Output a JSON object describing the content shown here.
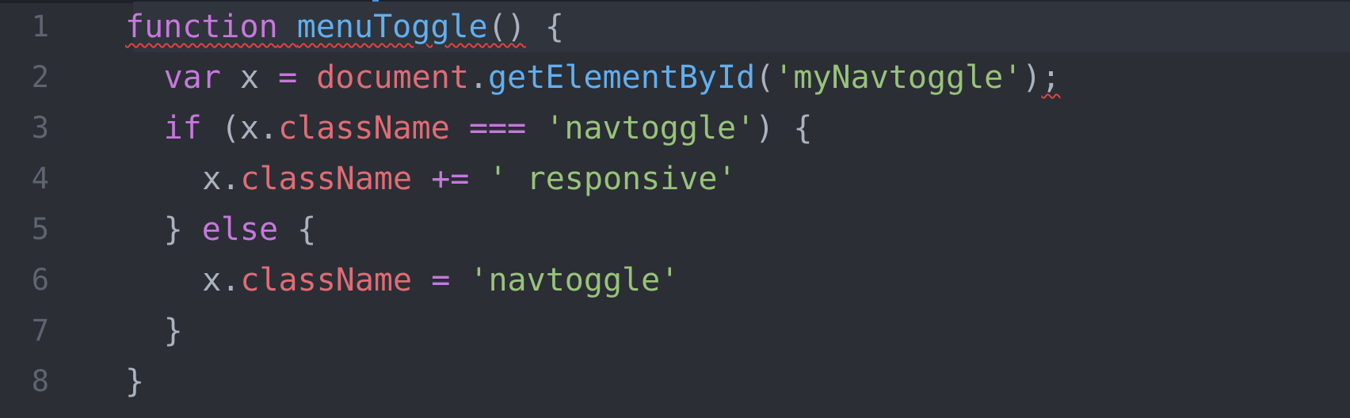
{
  "editor": {
    "lines": [
      {
        "number": "1",
        "indent": "",
        "tokens": [
          {
            "t": "function",
            "c": "kw",
            "s": true
          },
          {
            "t": " ",
            "c": "pl",
            "s": true
          },
          {
            "t": "menuToggle",
            "c": "fn",
            "s": true
          },
          {
            "t": "()",
            "c": "pl",
            "s": true
          },
          {
            "t": " {",
            "c": "pl"
          }
        ]
      },
      {
        "number": "2",
        "indent": "  ",
        "tokens": [
          {
            "t": "var",
            "c": "kw"
          },
          {
            "t": " x ",
            "c": "pl"
          },
          {
            "t": "=",
            "c": "op"
          },
          {
            "t": " ",
            "c": "pl"
          },
          {
            "t": "document",
            "c": "obj"
          },
          {
            "t": ".",
            "c": "pl"
          },
          {
            "t": "getElementById",
            "c": "fn"
          },
          {
            "t": "(",
            "c": "pl"
          },
          {
            "t": "'myNavtoggle'",
            "c": "str"
          },
          {
            "t": ")",
            "c": "pl"
          },
          {
            "t": ";",
            "c": "pl",
            "s": true
          }
        ]
      },
      {
        "number": "3",
        "indent": "  ",
        "tokens": [
          {
            "t": "if",
            "c": "kw"
          },
          {
            "t": " (x.",
            "c": "pl"
          },
          {
            "t": "className",
            "c": "obj"
          },
          {
            "t": " ",
            "c": "pl"
          },
          {
            "t": "===",
            "c": "op"
          },
          {
            "t": " ",
            "c": "pl"
          },
          {
            "t": "'navtoggle'",
            "c": "str"
          },
          {
            "t": ") {",
            "c": "pl"
          }
        ]
      },
      {
        "number": "4",
        "indent": "    ",
        "tokens": [
          {
            "t": "x.",
            "c": "pl"
          },
          {
            "t": "className",
            "c": "obj"
          },
          {
            "t": " ",
            "c": "pl"
          },
          {
            "t": "+=",
            "c": "op"
          },
          {
            "t": " ",
            "c": "pl"
          },
          {
            "t": "' responsive'",
            "c": "str"
          }
        ]
      },
      {
        "number": "5",
        "indent": "  ",
        "tokens": [
          {
            "t": "} ",
            "c": "pl"
          },
          {
            "t": "else",
            "c": "kw"
          },
          {
            "t": " {",
            "c": "pl"
          }
        ]
      },
      {
        "number": "6",
        "indent": "    ",
        "tokens": [
          {
            "t": "x.",
            "c": "pl"
          },
          {
            "t": "className",
            "c": "obj"
          },
          {
            "t": " ",
            "c": "pl"
          },
          {
            "t": "=",
            "c": "op"
          },
          {
            "t": " ",
            "c": "pl"
          },
          {
            "t": "'navtoggle'",
            "c": "str"
          }
        ]
      },
      {
        "number": "7",
        "indent": "  ",
        "tokens": [
          {
            "t": "}",
            "c": "pl"
          }
        ]
      },
      {
        "number": "8",
        "indent": "",
        "tokens": [
          {
            "t": "}",
            "c": "pl"
          }
        ]
      }
    ]
  },
  "colors": {
    "background": "#2b2e35",
    "active_line": "#30343c",
    "keyword": "#c678dd",
    "function": "#61afef",
    "object": "#e06c75",
    "string": "#98c379",
    "plain": "#abb2bf",
    "gutter_text": "#5e6470",
    "error_squiggle": "#e0453f"
  }
}
